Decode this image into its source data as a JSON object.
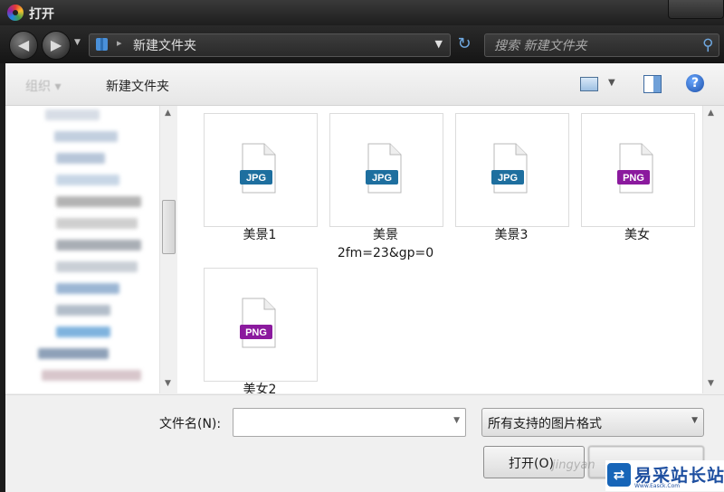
{
  "window": {
    "title": "打开"
  },
  "address_bar": {
    "path": "新建文件夹",
    "search_placeholder": "搜索 新建文件夹"
  },
  "toolbar": {
    "organize_label": "组织 ▾",
    "new_folder_label": "新建文件夹",
    "help_label": "?"
  },
  "files": [
    {
      "label": "美景1",
      "type": "JPG",
      "color": "#1e6f9f"
    },
    {
      "label": "美景\n2fm=23&gp=0",
      "type": "JPG",
      "color": "#1e6f9f"
    },
    {
      "label": "美景3",
      "type": "JPG",
      "color": "#1e6f9f"
    },
    {
      "label": "美女",
      "type": "PNG",
      "color": "#8b1a9e"
    },
    {
      "label": "美女2",
      "type": "PNG",
      "color": "#8b1a9e"
    }
  ],
  "bottom": {
    "filename_label": "文件名(N):",
    "filename_value": "",
    "filetype_value": "所有支持的图片格式",
    "open_label": "打开(O)"
  },
  "watermark": {
    "brand": "易采站长站",
    "sub": "Www.Easck.Com",
    "faint": "jingyan"
  }
}
